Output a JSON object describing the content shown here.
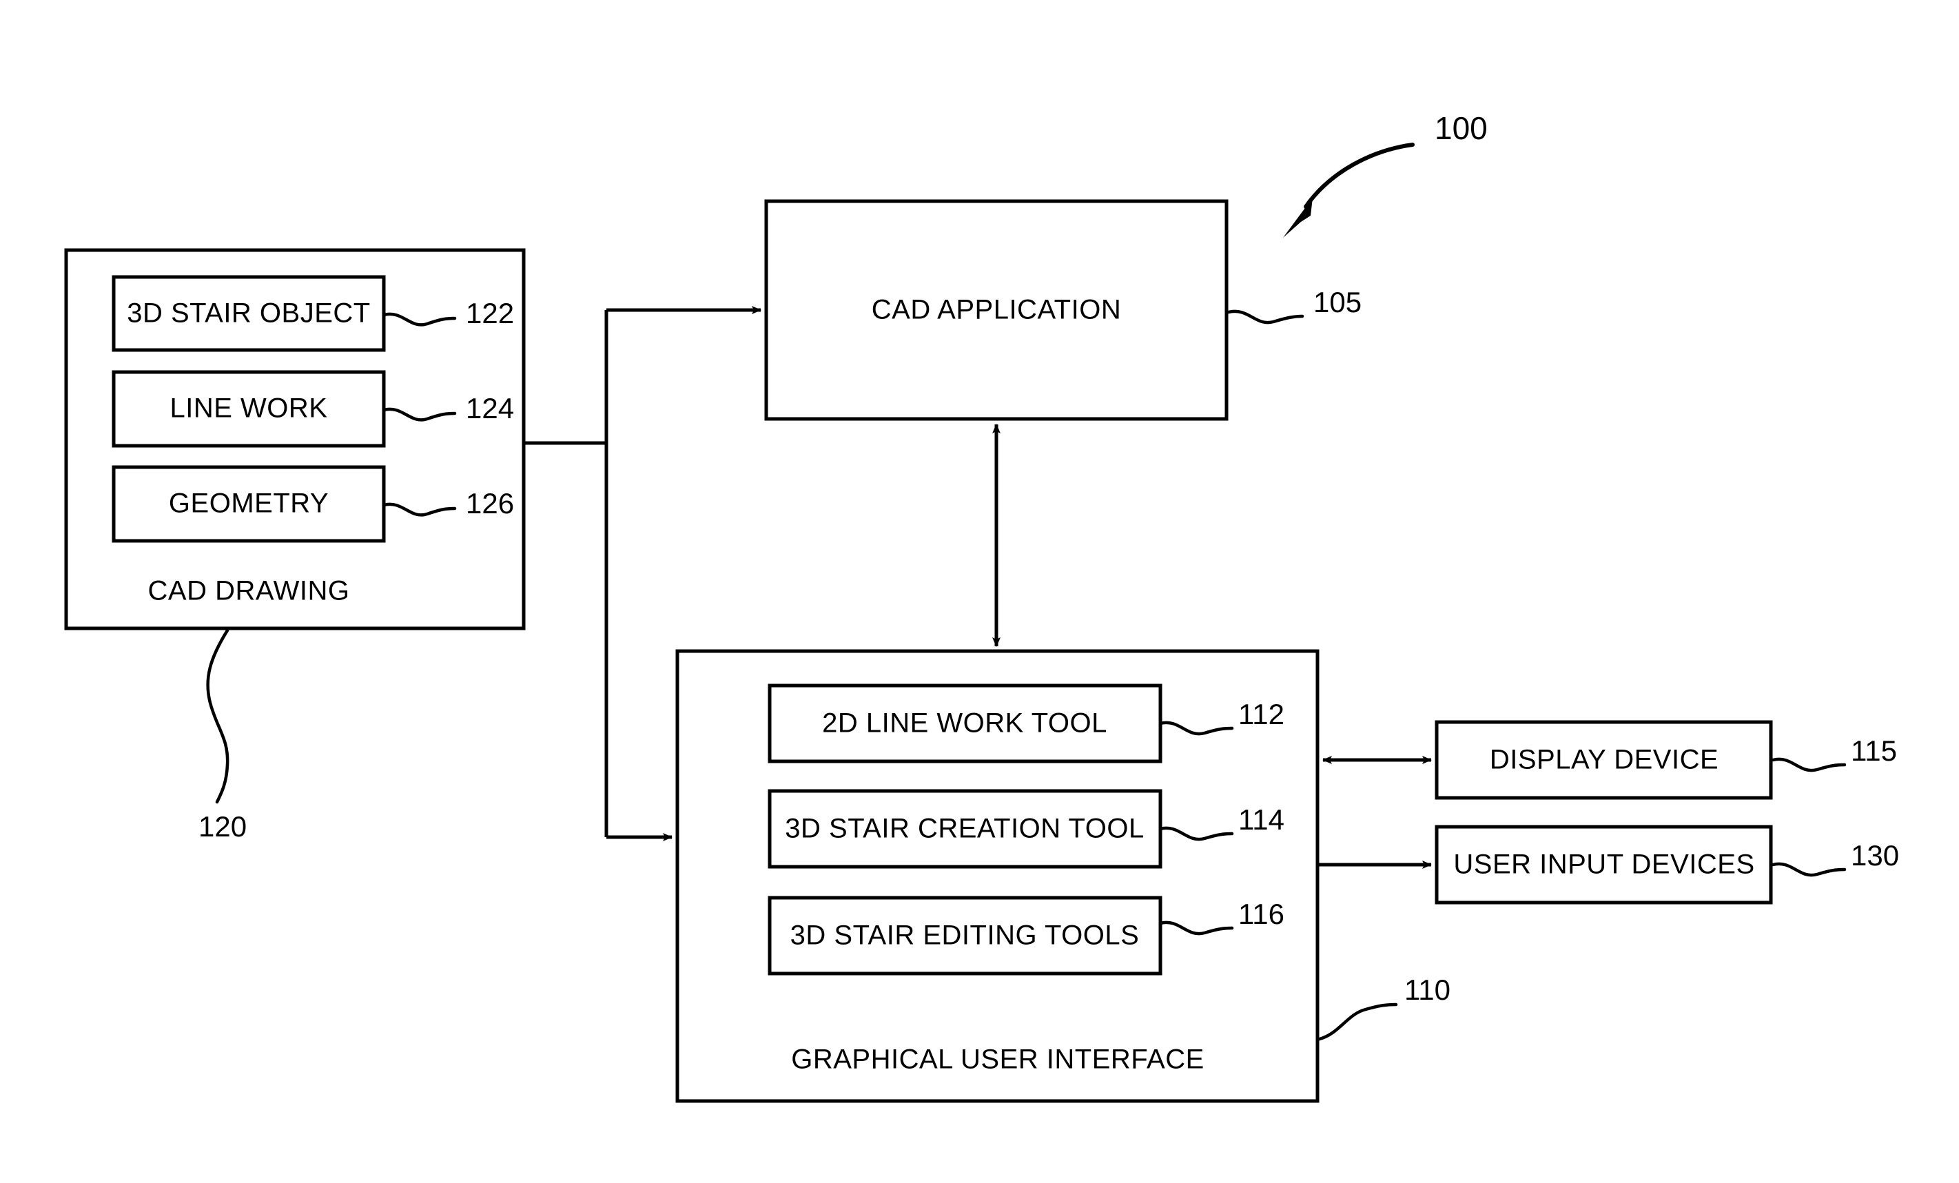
{
  "figure": {
    "title_ref": "100",
    "background_color": "#ffffff",
    "line_color": "#000000"
  },
  "blocks": {
    "cad_drawing": {
      "caption": "CAD DRAWING",
      "ref": "120",
      "items": [
        {
          "label": "3D STAIR OBJECT",
          "ref": "122"
        },
        {
          "label": "LINE WORK",
          "ref": "124"
        },
        {
          "label": "GEOMETRY",
          "ref": "126"
        }
      ]
    },
    "cad_application": {
      "label": "CAD APPLICATION",
      "ref": "105"
    },
    "gui": {
      "caption": "GRAPHICAL USER INTERFACE",
      "ref": "110",
      "items": [
        {
          "label": "2D LINE WORK TOOL",
          "ref": "112"
        },
        {
          "label": "3D STAIR CREATION TOOL",
          "ref": "114"
        },
        {
          "label": "3D STAIR EDITING TOOLS",
          "ref": "116"
        }
      ]
    },
    "display_device": {
      "label": "DISPLAY DEVICE",
      "ref": "115"
    },
    "user_input_devices": {
      "label": "USER INPUT DEVICES",
      "ref": "130"
    }
  }
}
